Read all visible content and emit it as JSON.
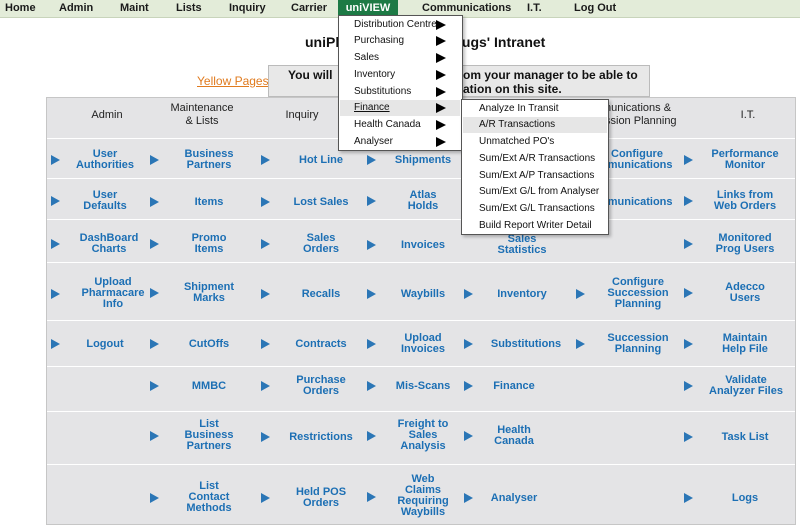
{
  "nav": {
    "home": "Home",
    "admin": "Admin",
    "maint": "Maint",
    "lists": "Lists",
    "inquiry": "Inquiry",
    "carrier": "Carrier",
    "uniview": "uniVIEW",
    "communications": "Communications",
    "it": "I.T.",
    "logout": "Log Out"
  },
  "header": {
    "title_left": "uniPh",
    "title_right": "ugs' Intranet",
    "yellow_pages": "Yellow Pages",
    "notice_line1_left": "You will",
    "notice_line1_right": "om your manager to be able to",
    "notice_line2_right": "ation on this site."
  },
  "grid": {
    "headers": {
      "admin": "Admin",
      "maintenance_1": "Maintenance",
      "maintenance_2": "& Lists",
      "inquiry": "Inquiry",
      "comm_1": "nunications &",
      "comm_2": "ssion Planning",
      "it": "I.T."
    },
    "admin": {
      "user_authorities_1": "User",
      "user_authorities_2": "Authorities",
      "user_defaults_1": "User",
      "user_defaults_2": "Defaults",
      "dashboard_1": "DashBoard",
      "dashboard_2": "Charts",
      "upload_pharmacare_1": "Upload",
      "upload_pharmacare_2": "Pharmacare",
      "upload_pharmacare_3": "Info",
      "logout": "Logout"
    },
    "maint": {
      "business_partners_1": "Business",
      "business_partners_2": "Partners",
      "items": "Items",
      "promo_items_1": "Promo",
      "promo_items_2": "Items",
      "shipment_marks_1": "Shipment",
      "shipment_marks_2": "Marks",
      "cutoffs": "CutOffs",
      "mmbc": "MMBC",
      "list_business_partners_1": "List",
      "list_business_partners_2": "Business",
      "list_business_partners_3": "Partners",
      "list_contact_methods_1": "List",
      "list_contact_methods_2": "Contact",
      "list_contact_methods_3": "Methods"
    },
    "inquiry": {
      "hot_line": "Hot Line",
      "lost_sales": "Lost Sales",
      "sales_orders_1": "Sales",
      "sales_orders_2": "Orders",
      "recalls": "Recalls",
      "contracts": "Contracts",
      "purchase_orders_1": "Purchase",
      "purchase_orders_2": "Orders",
      "restrictions": "Restrictions",
      "held_pos_1": "Held POS",
      "held_pos_2": "Orders"
    },
    "col4": {
      "shipments": "Shipments",
      "atlas_holds_1": "Atlas",
      "atlas_holds_2": "Holds",
      "invoices": "Invoices",
      "waybills": "Waybills",
      "upload_invoices_1": "Upload",
      "upload_invoices_2": "Invoices",
      "mis_scans": "Mis-Scans",
      "freight_1": "Freight to",
      "freight_2": "Sales",
      "freight_3": "Analysis",
      "web_claims_1": "Web",
      "web_claims_2": "Claims",
      "web_claims_3": "Requiring",
      "web_claims_4": "Waybills"
    },
    "col5": {
      "sales_statistics_1": "Sales",
      "sales_statistics_2": "Statistics",
      "inventory": "Inventory",
      "substitutions": "Substitutions",
      "finance": "Finance",
      "health_canada_1": "Health",
      "health_canada_2": "Canada",
      "analyser": "Analyser"
    },
    "comm": {
      "configure_comm_1": "Configure",
      "configure_comm_2": "nmunications",
      "communications": "nmunications",
      "configure_succession_1": "Configure",
      "configure_succession_2": "Succession",
      "configure_succession_3": "Planning",
      "succession_1": "Succession",
      "succession_2": "Planning"
    },
    "it": {
      "performance_monitor_1": "Performance",
      "performance_monitor_2": "Monitor",
      "links_web_orders_1": "Links from",
      "links_web_orders_2": "Web Orders",
      "monitored_prog_1": "Monitored",
      "monitored_prog_2": "Prog Users",
      "adecco_users_1": "Adecco",
      "adecco_users_2": "Users",
      "maintain_help_1": "Maintain",
      "maintain_help_2": "Help File",
      "validate_analyzer_1": "Validate",
      "validate_analyzer_2": "Analyzer Files",
      "task_list": "Task List",
      "logs": "Logs"
    }
  },
  "dropdown": {
    "items": [
      "Distribution Centre",
      "Purchasing",
      "Sales",
      "Inventory",
      "Substitutions",
      "Finance",
      "Health Canada",
      "Analyser"
    ],
    "highlighted": "Finance"
  },
  "submenu": {
    "items": [
      "Analyze In Transit",
      "A/R Transactions",
      "Unmatched PO's",
      "Sum/Ext A/R Transactions",
      "Sum/Ext A/P Transactions",
      "Sum/Ext G/L from Analyser",
      "Sum/Ext G/L Transactions",
      "Build Report Writer Detail"
    ],
    "highlighted": "A/R Transactions"
  },
  "colors": {
    "nav_bg": "#e3ecd9",
    "nav_active": "#1d7a45",
    "link_blue": "#1c6fb4",
    "arrow_blue": "#2b76b6",
    "grid_bg": "#e4e4e6",
    "yellow_pages": "#e07b1f"
  }
}
